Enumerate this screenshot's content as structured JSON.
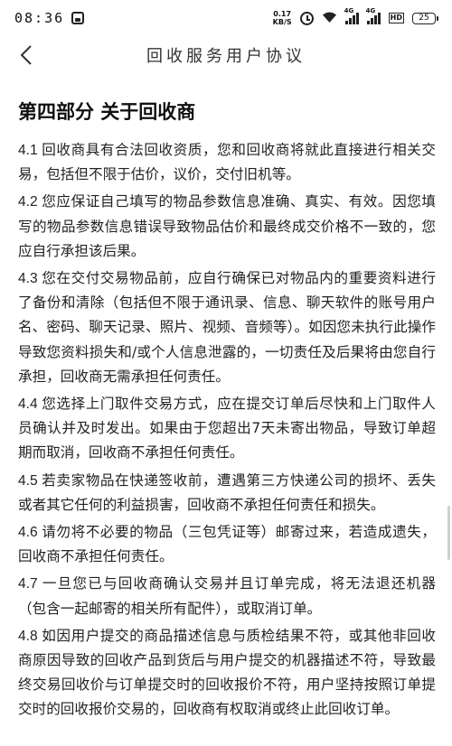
{
  "status_bar": {
    "time": "08:36",
    "net_speed_value": "0.17",
    "net_speed_unit": "KB/S",
    "signal_1_label": "4G",
    "signal_2_label": "4G",
    "hd_label": "HD",
    "battery": "25"
  },
  "header": {
    "back_icon": "chevron-left-icon",
    "title": "回收服务用户协议"
  },
  "section": {
    "title": "第四部分 关于回收商",
    "clauses": [
      {
        "num": "4.1",
        "text": "回收商具有合法回收资质，您和回收商将就此直接进行相关交易，包括但不限于估价，议价，交付旧机等。"
      },
      {
        "num": "4.2",
        "text": "您应保证自己填写的物品参数信息准确、真实、有效。因您填写的物品参数信息错误导致物品估价和最终成交价格不一致的，您应自行承担该后果。"
      },
      {
        "num": "4.3",
        "text": "您在交付交易物品前，应自行确保已对物品内的重要资料进行了备份和清除（包括但不限于通讯录、信息、聊天软件的账号用户名、密码、聊天记录、照片、视频、音频等）。如因您未执行此操作导致您资料损失和/或个人信息泄露的，一切责任及后果将由您自行承担，回收商无需承担任何责任。"
      },
      {
        "num": "4.4",
        "text": "您选择上门取件交易方式，应在提交订单后尽快和上门取件人员确认并及时发出。如果由于您超出7天未寄出物品，导致订单超期而取消，回收商不承担任何责任。"
      },
      {
        "num": "4.5",
        "text": "若卖家物品在快递签收前，遭遇第三方快递公司的损坏、丢失或者其它任何的利益损害，回收商不承担任何责任和损失。"
      },
      {
        "num": "4.6",
        "text": "请勿将不必要的物品（三包凭证等）邮寄过来，若造成遗失，回收商不承担任何责任。"
      },
      {
        "num": "4.7",
        "text": "一旦您已与回收商确认交易并且订单完成，将无法退还机器（包含一起邮寄的相关所有配件），或取消订单。"
      },
      {
        "num": "4.8",
        "text": "如因用户提交的商品描述信息与质检结果不符，或其他非回收商原因导致的回收产品到货后与用户提交的机器描述不符，导致最终交易回收价与订单提交时的回收报价不符，用户坚持按照订单提交时的回收报价交易的，回收商有权取消或终止此回收订单。"
      }
    ]
  }
}
